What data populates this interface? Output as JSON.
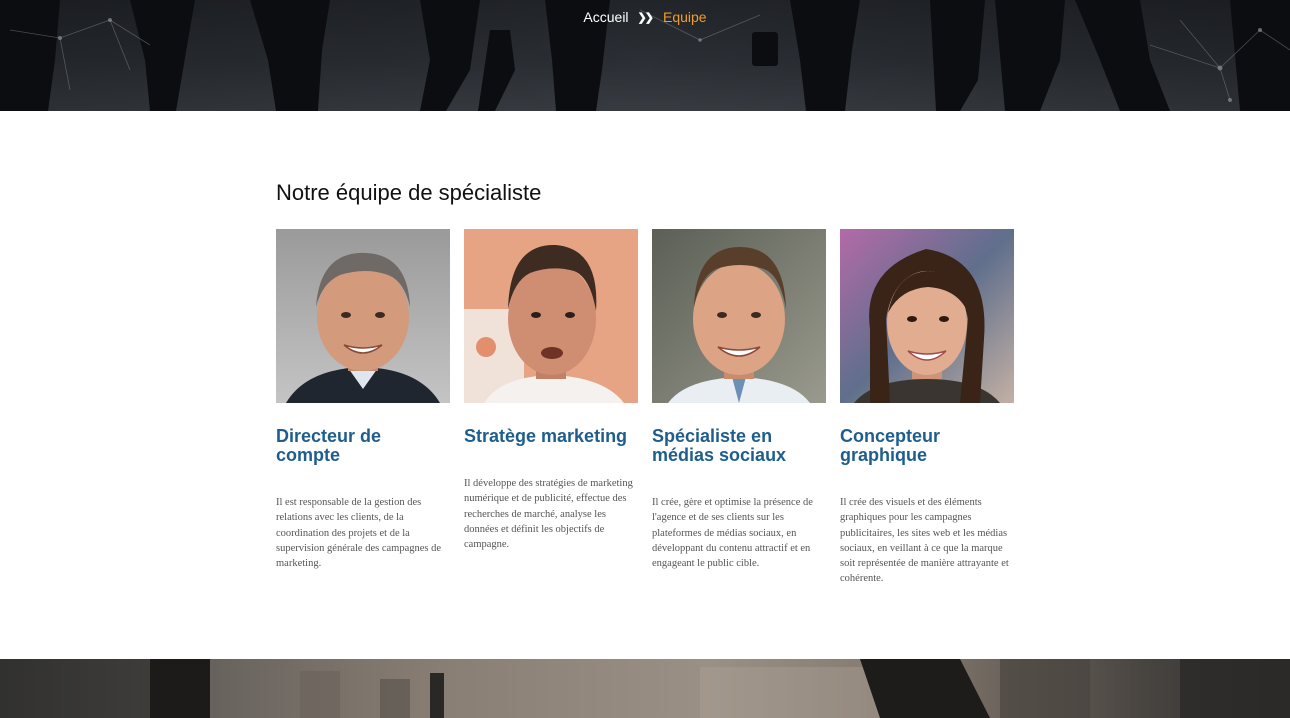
{
  "breadcrumb": {
    "home": "Accueil",
    "separator_icon": "double-chevron-right-icon",
    "current": "Equipe"
  },
  "colors": {
    "breadcrumb_current": "#f39c29",
    "role_title": "#1f5e8c",
    "banner_dark": "#2d3137"
  },
  "team": {
    "title": "Notre équipe de spécialiste",
    "members": [
      {
        "role": "Directeur de compte",
        "description": "Il est responsable de la gestion des relations avec les clients, de la coordination des projets et de la supervision générale des campagnes de marketing."
      },
      {
        "role": "Stratège marketing",
        "description": "Il développe des stratégies de marketing numérique et de publicité, effectue des recherches de marché, analyse les données et définit les objectifs de campagne."
      },
      {
        "role": "Spécialiste en médias sociaux",
        "description": "Il crée, gère et optimise la présence de l'agence et de ses clients sur les plateformes de médias sociaux, en développant du contenu attractif et en engageant le public cible."
      },
      {
        "role": "Concepteur graphique",
        "description": " Il crée des visuels et des éléments graphiques pour les campagnes publicitaires, les sites web et les médias sociaux, en veillant à ce que la marque soit représentée de manière attrayante et cohérente."
      }
    ]
  }
}
